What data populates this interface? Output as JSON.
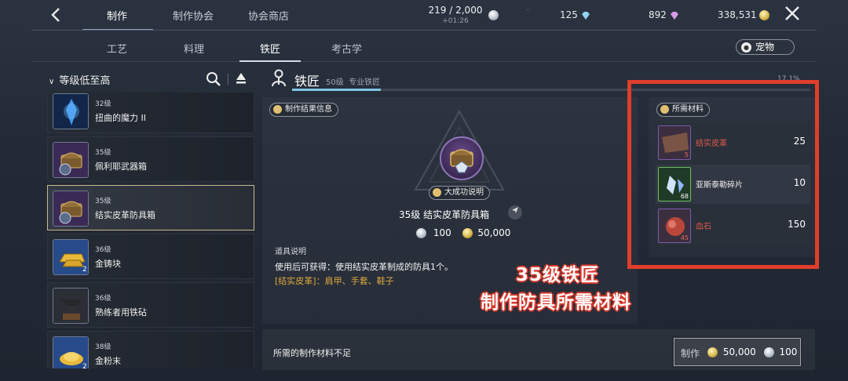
{
  "header": {
    "tabs": [
      {
        "label": "制作",
        "active": true
      },
      {
        "label": "制作协会",
        "active": false
      },
      {
        "label": "协会商店",
        "active": false
      }
    ],
    "stamina": {
      "value": "219 / 2,000",
      "timer": "+01:26"
    },
    "currencies": {
      "crystal": "125",
      "gem": "892",
      "gold": "338,531"
    }
  },
  "subtabs": [
    {
      "label": "工艺",
      "active": false
    },
    {
      "label": "料理",
      "active": false
    },
    {
      "label": "铁匠",
      "active": true
    },
    {
      "label": "考古学",
      "active": false
    }
  ],
  "pet_label": "宠物",
  "sort_label": "等级低至高",
  "items": [
    {
      "level": "32级",
      "name": "扭曲的魔力 II",
      "qty": "",
      "selected": false,
      "icon": "crystal-icon"
    },
    {
      "level": "35级",
      "name": "佩利耶武器箱",
      "qty": "",
      "selected": false,
      "icon": "chest-icon"
    },
    {
      "level": "35级",
      "name": "结实皮革防具箱",
      "qty": "",
      "selected": true,
      "icon": "chest-icon"
    },
    {
      "level": "36级",
      "name": "金铸块",
      "qty": "2",
      "selected": false,
      "icon": "gold-ingot-icon"
    },
    {
      "level": "36级",
      "name": "熟练者用铁砧",
      "qty": "",
      "selected": false,
      "icon": "anvil-icon"
    },
    {
      "level": "38级",
      "name": "金粉末",
      "qty": "2",
      "selected": false,
      "icon": "gold-powder-icon"
    }
  ],
  "smith": {
    "title": "铁匠",
    "level": "50级",
    "subtitle": "专业铁匠",
    "percent": "17.1%",
    "progress": 0.171
  },
  "result": {
    "pill": "制作结果信息",
    "success_pill": "大成功说明",
    "item_name": "35级  结实皮革防具箱",
    "cost_silver": "100",
    "cost_gold": "50,000",
    "desc_label": "道具说明",
    "desc_text": "使用后可获得：使用结实皮革制成的防具1个。",
    "desc_sub": "[结实皮革]：肩甲、手套、鞋子"
  },
  "overlay": {
    "line1": "35级铁匠",
    "line2": "制作防具所需材料"
  },
  "materials": {
    "pill": "所需材料",
    "rows": [
      {
        "name": "结实皮革",
        "qty": "25",
        "level": "5",
        "sufficient": false
      },
      {
        "name": "亚斯泰勒碎片",
        "qty": "10",
        "level": "68",
        "sufficient": true
      },
      {
        "name": "血石",
        "qty": "150",
        "level": "45",
        "sufficient": false
      }
    ]
  },
  "bottom": {
    "insufficient": "所需的制作材料不足",
    "craft_label": "制作",
    "craft_gold": "50,000",
    "craft_silver": "100"
  },
  "colors": {
    "insufficient": "#e0574a",
    "accent_bar": "#7fc6e6",
    "highlight_frame": "#e03d2b"
  }
}
